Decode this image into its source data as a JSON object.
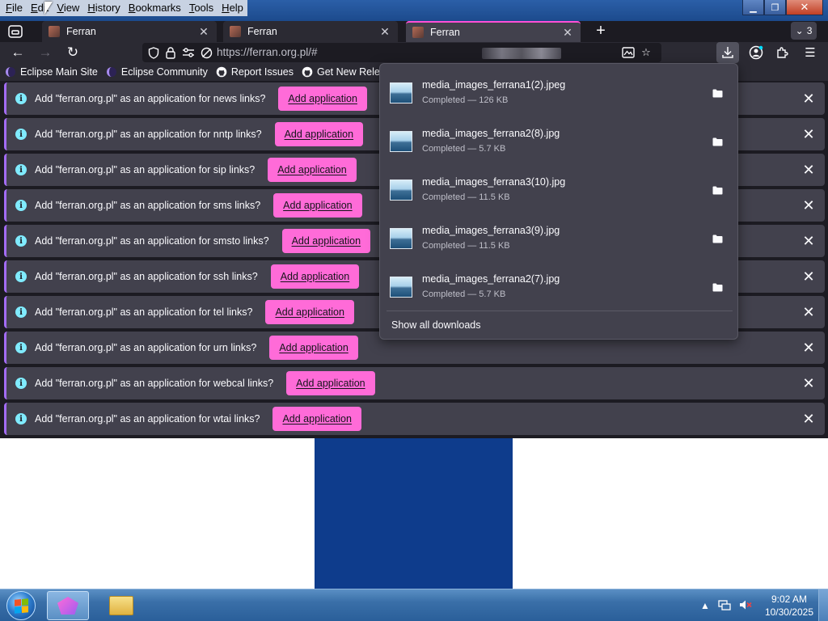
{
  "menubar": {
    "items": [
      {
        "accel": "F",
        "rest": "ile"
      },
      {
        "accel": "E",
        "rest": "dit"
      },
      {
        "accel": "V",
        "rest": "iew"
      },
      {
        "accel": "H",
        "rest": "istory"
      },
      {
        "accel": "B",
        "rest": "ookmarks"
      },
      {
        "accel": "T",
        "rest": "ools"
      },
      {
        "accel": "H",
        "rest": "elp"
      }
    ]
  },
  "window_controls": {
    "minimize": "▁",
    "maximize": "❐",
    "close": "✕"
  },
  "tabs": [
    {
      "label": "Ferran",
      "close": "✕"
    },
    {
      "label": "Ferran",
      "close": "✕"
    },
    {
      "label": "Ferran",
      "close": "✕"
    }
  ],
  "tab_bar": {
    "new_tab": "+",
    "tabs_count": "3"
  },
  "urlbar": {
    "url": "https://ferran.org.pl/#"
  },
  "bookmarks": [
    {
      "label": "Eclipse Main Site"
    },
    {
      "label": "Eclipse Community"
    },
    {
      "label": "Report Issues"
    },
    {
      "label": "Get New Releases"
    }
  ],
  "notifications": [
    {
      "text": "Add \"ferran.org.pl\" as an application for news links?",
      "button": "Add application"
    },
    {
      "text": "Add \"ferran.org.pl\" as an application for nntp links?",
      "button": "Add application"
    },
    {
      "text": "Add \"ferran.org.pl\" as an application for sip links?",
      "button": "Add application"
    },
    {
      "text": "Add \"ferran.org.pl\" as an application for sms links?",
      "button": "Add application"
    },
    {
      "text": "Add \"ferran.org.pl\" as an application for smsto links?",
      "button": "Add application"
    },
    {
      "text": "Add \"ferran.org.pl\" as an application for ssh links?",
      "button": "Add application"
    },
    {
      "text": "Add \"ferran.org.pl\" as an application for tel links?",
      "button": "Add application"
    },
    {
      "text": "Add \"ferran.org.pl\" as an application for urn links?",
      "button": "Add application"
    },
    {
      "text": "Add \"ferran.org.pl\" as an application for webcal links?",
      "button": "Add application"
    },
    {
      "text": "Add \"ferran.org.pl\" as an application for wtai links?",
      "button": "Add application"
    }
  ],
  "downloads": {
    "items": [
      {
        "name": "media_images_ferrana1(2).jpeg",
        "status": "Completed — 126 KB"
      },
      {
        "name": "media_images_ferrana2(8).jpg",
        "status": "Completed — 5.7 KB"
      },
      {
        "name": "media_images_ferrana3(10).jpg",
        "status": "Completed — 11.5 KB"
      },
      {
        "name": "media_images_ferrana3(9).jpg",
        "status": "Completed — 11.5 KB"
      },
      {
        "name": "media_images_ferrana2(7).jpg",
        "status": "Completed — 5.7 KB"
      }
    ],
    "show_all": "Show all downloads"
  },
  "taskbar": {
    "time": "9:02 AM",
    "date": "10/30/2025"
  },
  "colors": {
    "accent": "#ff6bd8",
    "notification_bg": "#42414d",
    "page_block": "#0e3c8c"
  }
}
